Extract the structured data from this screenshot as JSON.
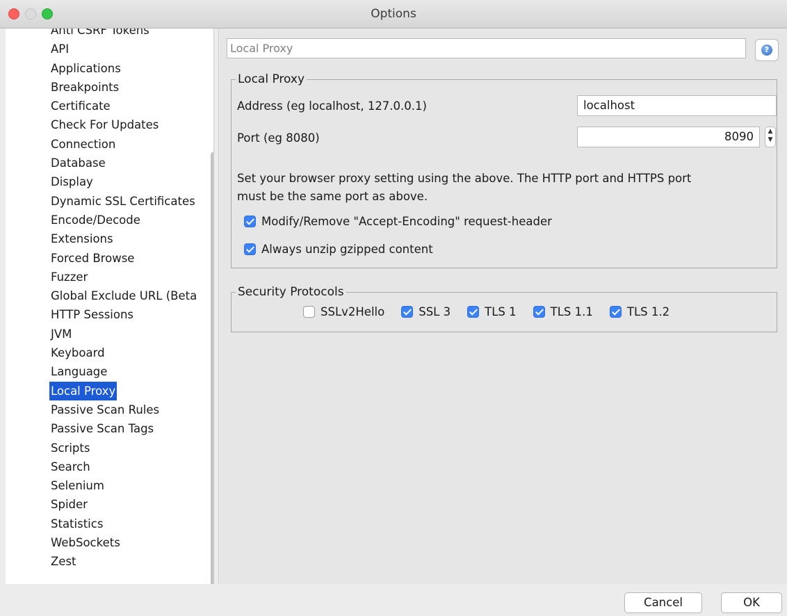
{
  "window": {
    "title": "Options"
  },
  "tree": {
    "items": [
      "Anti CSRF Tokens",
      "API",
      "Applications",
      "Breakpoints",
      "Certificate",
      "Check For Updates",
      "Connection",
      "Database",
      "Display",
      "Dynamic SSL Certificates",
      "Encode/Decode",
      "Extensions",
      "Forced Browse",
      "Fuzzer",
      "Global Exclude URL (Beta",
      "HTTP Sessions",
      "JVM",
      "Keyboard",
      "Language",
      "Local Proxy",
      "Passive Scan Rules",
      "Passive Scan Tags",
      "Scripts",
      "Search",
      "Selenium",
      "Spider",
      "Statistics",
      "WebSockets",
      "Zest"
    ],
    "selected": "Local Proxy"
  },
  "panel": {
    "header": "Local Proxy",
    "local_proxy": {
      "legend": "Local Proxy",
      "address_label": "Address (eg localhost, 127.0.0.1)",
      "address_value": "localhost",
      "port_label": "Port (eg 8080)",
      "port_value": "8090",
      "note_line1": "Set your browser proxy setting using the above. The HTTP port and HTTPS port",
      "note_line2": "must be the same port as above.",
      "modify_encoding_label": "Modify/Remove \"Accept-Encoding\" request-header",
      "modify_encoding_checked": true,
      "unzip_label": "Always unzip gzipped content",
      "unzip_checked": true
    },
    "security": {
      "legend": "Security Protocols",
      "protocols": [
        {
          "label": "SSLv2Hello",
          "checked": false
        },
        {
          "label": "SSL 3",
          "checked": true
        },
        {
          "label": "TLS 1",
          "checked": true
        },
        {
          "label": "TLS 1.1",
          "checked": true
        },
        {
          "label": "TLS 1.2",
          "checked": true
        }
      ]
    }
  },
  "buttons": {
    "cancel": "Cancel",
    "ok": "OK"
  },
  "colors": {
    "selection": "#1d5bd6",
    "checkbox": "#3a82f6",
    "close": "#fc605c",
    "zoom": "#34c84a"
  },
  "icons": {
    "help": "help-icon"
  }
}
